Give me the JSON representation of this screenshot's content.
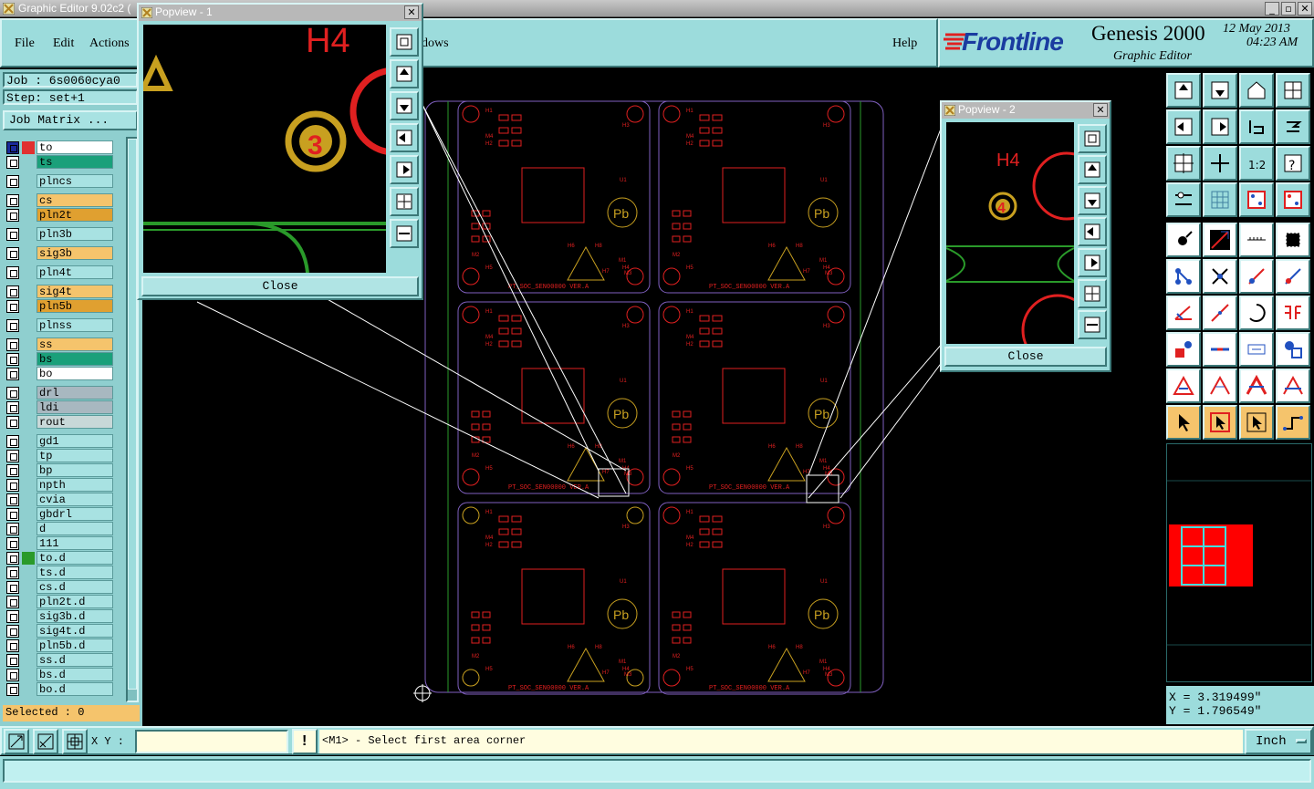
{
  "window": {
    "title": "Graphic Editor 9.02c2 (",
    "min_icon": "minimize-icon",
    "max_icon": "maximize-icon",
    "close_icon": "close-icon"
  },
  "menu": {
    "file": "File",
    "edit": "Edit",
    "actions": "Actions",
    "windows": "dows",
    "help": "Help"
  },
  "brand": {
    "logo": "Frontline",
    "product": "Genesis 2000",
    "subtitle": "Graphic Editor",
    "date": "12 May 2013",
    "time": "04:23 AM"
  },
  "job": {
    "job_label": "Job : 6s0060cya0",
    "step_label": "Step: set+1",
    "matrix_button": "Job Matrix ..."
  },
  "layers": [
    {
      "name": "to",
      "bg": "#ffffff",
      "mark": "#e03030"
    },
    {
      "name": "ts",
      "bg": "#1aa07a",
      "mark": ""
    },
    {
      "name": "plncs",
      "bg": "#a8e2e2",
      "mark": ""
    },
    {
      "name": "cs",
      "bg": "#f5c46c",
      "mark": ""
    },
    {
      "name": "pln2t",
      "bg": "#e0a030",
      "mark": ""
    },
    {
      "name": "pln3b",
      "bg": "#a8e2e2",
      "mark": ""
    },
    {
      "name": "sig3b",
      "bg": "#f5c46c",
      "mark": ""
    },
    {
      "name": "pln4t",
      "bg": "#a8e2e2",
      "mark": ""
    },
    {
      "name": "sig4t",
      "bg": "#f5c46c",
      "mark": ""
    },
    {
      "name": "pln5b",
      "bg": "#e0a030",
      "mark": ""
    },
    {
      "name": "plnss",
      "bg": "#a8e2e2",
      "mark": ""
    },
    {
      "name": "ss",
      "bg": "#f5c46c",
      "mark": ""
    },
    {
      "name": "bs",
      "bg": "#1aa07a",
      "mark": ""
    },
    {
      "name": "bo",
      "bg": "#ffffff",
      "mark": ""
    },
    {
      "name": "drl",
      "bg": "#a8b8c0",
      "mark": ""
    },
    {
      "name": "ldi",
      "bg": "#a8b8c0",
      "mark": ""
    },
    {
      "name": "rout",
      "bg": "#c8d8d8",
      "mark": ""
    },
    {
      "name": "gd1",
      "bg": "#a8e2e2",
      "mark": ""
    },
    {
      "name": "tp",
      "bg": "#a8e2e2",
      "mark": ""
    },
    {
      "name": "bp",
      "bg": "#a8e2e2",
      "mark": ""
    },
    {
      "name": "npth",
      "bg": "#a8e2e2",
      "mark": ""
    },
    {
      "name": "cvia",
      "bg": "#a8e2e2",
      "mark": ""
    },
    {
      "name": "gbdrl",
      "bg": "#a8e2e2",
      "mark": ""
    },
    {
      "name": "d",
      "bg": "#a8e2e2",
      "mark": ""
    },
    {
      "name": "111",
      "bg": "#a8e2e2",
      "mark": ""
    },
    {
      "name": "to.d",
      "bg": "#a8e2e2",
      "mark": "#2a9a2a"
    },
    {
      "name": "ts.d",
      "bg": "#a8e2e2",
      "mark": ""
    },
    {
      "name": "cs.d",
      "bg": "#a8e2e2",
      "mark": ""
    },
    {
      "name": "pln2t.d",
      "bg": "#a8e2e2",
      "mark": ""
    },
    {
      "name": "sig3b.d",
      "bg": "#a8e2e2",
      "mark": ""
    },
    {
      "name": "sig4t.d",
      "bg": "#a8e2e2",
      "mark": ""
    },
    {
      "name": "pln5b.d",
      "bg": "#a8e2e2",
      "mark": ""
    },
    {
      "name": "ss.d",
      "bg": "#a8e2e2",
      "mark": ""
    },
    {
      "name": "bs.d",
      "bg": "#a8e2e2",
      "mark": ""
    },
    {
      "name": "bo.d",
      "bg": "#a8e2e2",
      "mark": ""
    }
  ],
  "selected": "Selected : 0",
  "bottom": {
    "xy_label": "X Y :",
    "xy_value": "",
    "prompt": "<M1> - Select first area corner",
    "units": "Inch"
  },
  "coords": {
    "x": "X = 3.319499\"",
    "y": "Y = 1.796549\""
  },
  "popview1": {
    "title": "Popview - 1",
    "label": "H4",
    "pad_number": "3",
    "close": "Close"
  },
  "popview2": {
    "title": "Popview - 2",
    "label": "H4",
    "pad_number": "4",
    "close": "Close"
  },
  "board": {
    "footer_text": "PT_SOC_SEN00000  VER.A",
    "hole_labels": [
      "H1",
      "H2",
      "H3",
      "H4",
      "H5",
      "H6",
      "H7",
      "H8",
      "M1",
      "M2",
      "M3",
      "M4",
      "U1"
    ],
    "pb_label": "Pb"
  },
  "colors": {
    "accent": "#9cdcdc",
    "layer_red": "#e02020",
    "layer_yellow": "#c8a020",
    "outline": "#8060c0"
  }
}
